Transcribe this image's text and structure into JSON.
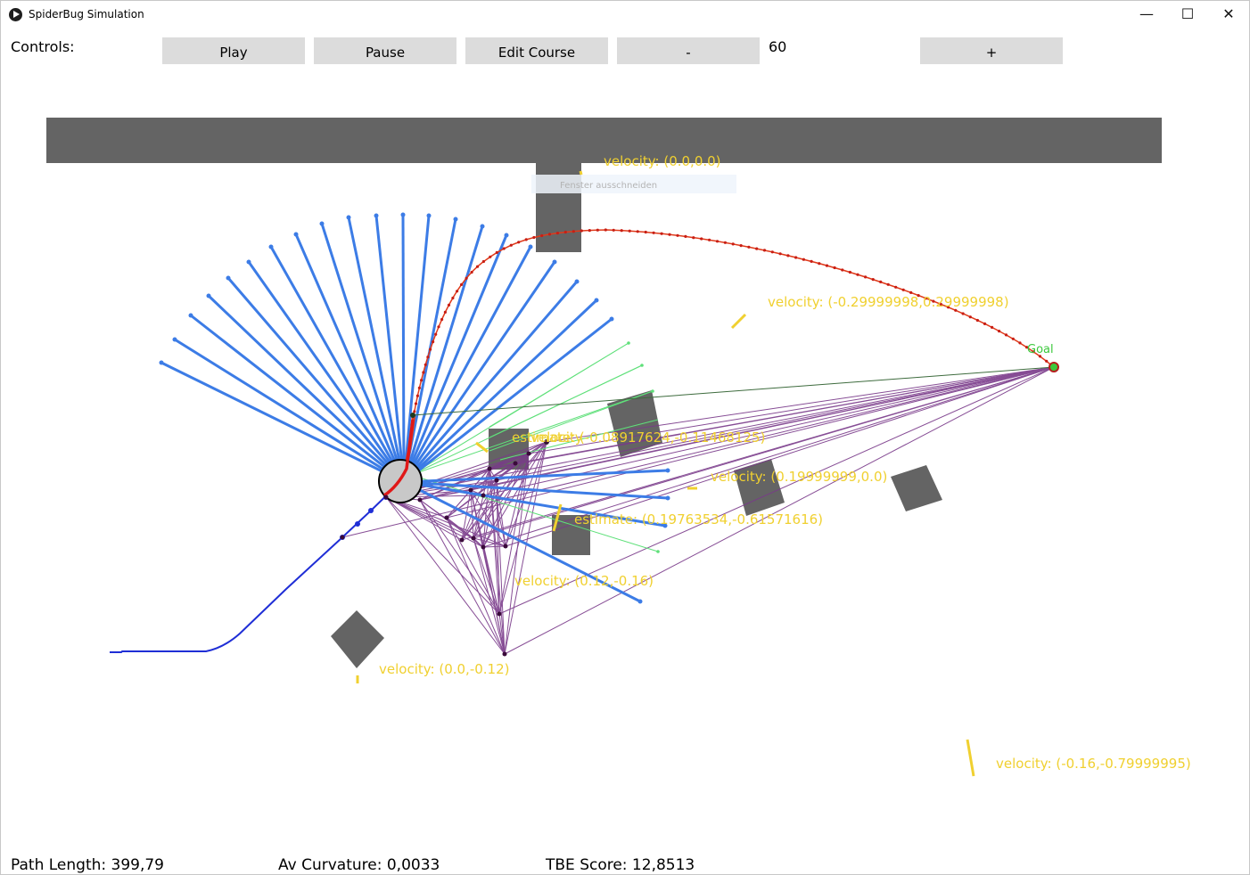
{
  "window": {
    "title": "SpiderBug Simulation",
    "minimize": "—",
    "maximize": "☐",
    "close": "✕"
  },
  "controls": {
    "label": "Controls:",
    "play": "Play",
    "pause": "Pause",
    "edit_course": "Edit Course",
    "minus": "-",
    "speed_value": "60",
    "plus": "+"
  },
  "scene": {
    "goal_label": "Goal",
    "ghost_tooltip": "Fenster ausschneiden",
    "velocity_labels": [
      "velocity: (0.0,0.0)",
      "velocity: (-0.29999998,0.29999998)",
      "velocity: (0.19999999,0.0)",
      "velocity: (0.12,-0.16)",
      "velocity: (0.0,-0.12)",
      "velocity: (-0.16,-0.79999995)"
    ],
    "estimate_labels": [
      "estimate: (-0.08917624,-0.11468125)",
      "estimate: (0.19763534,-0.61571616)"
    ],
    "overlap_label": "velocity"
  },
  "stats": {
    "path_length": "Path Length: 399,79",
    "av_curvature": "Av Curvature: 0,0033",
    "tbe_score": "TBE Score: 12,8513"
  },
  "colors": {
    "obstacle": "#646464",
    "ray_blue": "#3c7ce6",
    "ray_green": "#5fe07a",
    "visibility_purple": "#7a3a8a",
    "past_path": "#1f2ed6",
    "planned_path": "#e03a1a",
    "label_yellow": "#f0d030",
    "goal_green": "#3cc83c"
  }
}
